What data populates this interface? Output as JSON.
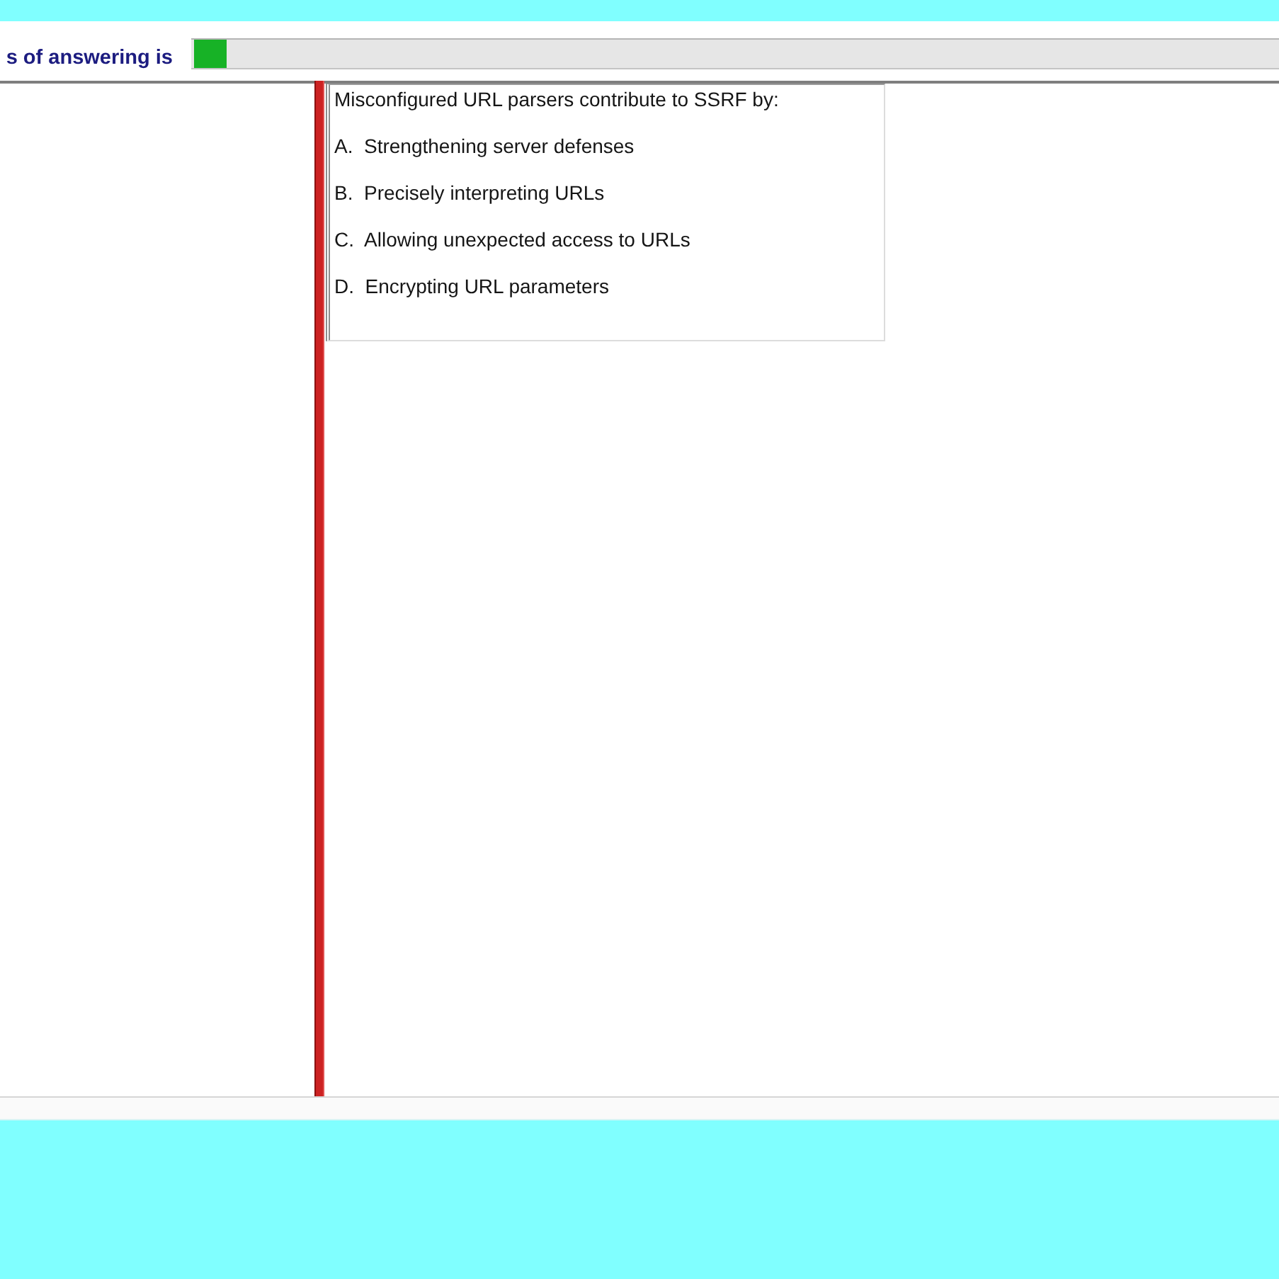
{
  "progress": {
    "label": "s of answering is",
    "level": 0.03
  },
  "question": {
    "text": "Misconfigured URL parsers contribute to SSRF by:",
    "options": [
      "A.  Strengthening server defenses",
      "B.  Precisely interpreting URLs",
      "C.  Allowing unexpected access to URLs",
      "D.  Encrypting URL parameters"
    ]
  }
}
